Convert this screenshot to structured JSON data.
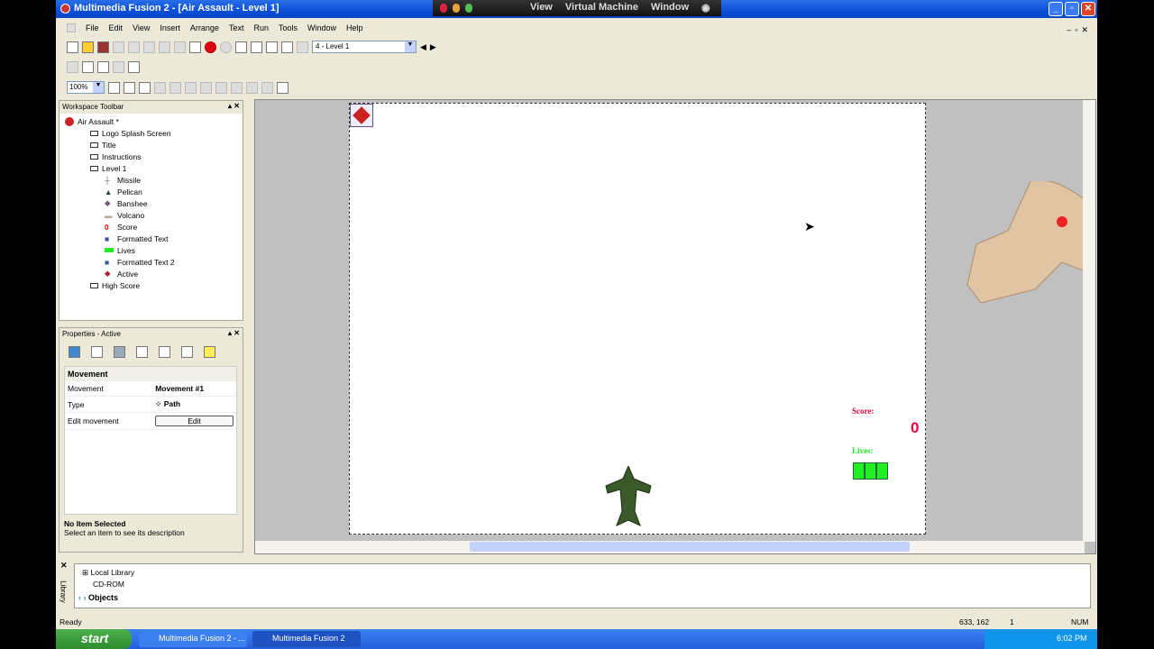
{
  "window": {
    "title": "Multimedia Fusion 2 - [Air Assault - Level 1]"
  },
  "vm_menu": [
    "View",
    "Virtual Machine",
    "Window"
  ],
  "menu": [
    "File",
    "Edit",
    "View",
    "Insert",
    "Arrange",
    "Text",
    "Run",
    "Tools",
    "Window",
    "Help"
  ],
  "toolbar": {
    "frame_select": "4 - Level 1",
    "zoom": "100%"
  },
  "workspace": {
    "title": "Workspace Toolbar",
    "root": "Air Assault *",
    "frames": [
      {
        "label": "Logo Splash Screen"
      },
      {
        "label": "Title"
      },
      {
        "label": "Instructions"
      },
      {
        "label": "Level 1"
      }
    ],
    "objects": [
      {
        "label": "Missile",
        "icon": "missile-icon"
      },
      {
        "label": "Pelican",
        "icon": "pelican-icon"
      },
      {
        "label": "Banshee",
        "icon": "banshee-icon"
      },
      {
        "label": "Volcano",
        "icon": "volcano-icon"
      },
      {
        "label": "Score",
        "icon": "score-icon"
      },
      {
        "label": "Formatted Text",
        "icon": "formatted-text-icon"
      },
      {
        "label": "Lives",
        "icon": "lives-icon"
      },
      {
        "label": "Formatted Text 2",
        "icon": "formatted-text-icon"
      },
      {
        "label": "Active",
        "icon": "active-icon"
      }
    ],
    "last": "High Score"
  },
  "properties": {
    "title": "Properties - Active",
    "section": "Movement",
    "rows": [
      {
        "label": "Movement",
        "value": "Movement #1"
      },
      {
        "label": "Type",
        "value": "Path"
      },
      {
        "label": "Edit movement",
        "value": "Edit"
      }
    ],
    "desc_title": "No Item Selected",
    "desc_text": "Select an item to see its description"
  },
  "game": {
    "score_label": "Score:",
    "score_value": "0",
    "lives_label": "Lives:",
    "lives_count": 3,
    "score_color": "#e8003c",
    "lives_color": "#22ee22"
  },
  "library": {
    "tab_label": "Library",
    "items": [
      "Local Library",
      "CD-ROM"
    ],
    "tab": "Objects"
  },
  "status": {
    "text": "Ready",
    "coords": "633, 162",
    "layer": "1",
    "num": "NUM"
  },
  "taskbar": {
    "start": "start",
    "tasks": [
      "Multimedia Fusion 2 - ...",
      "Multimedia Fusion 2"
    ],
    "clock": "6:02 PM"
  }
}
